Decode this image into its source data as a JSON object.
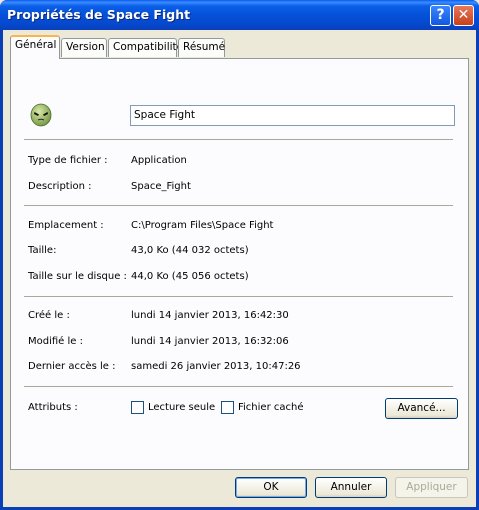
{
  "window": {
    "title": "Propriétés de Space Fight",
    "help_glyph": "?",
    "close_glyph": "✕"
  },
  "tabs": [
    {
      "label": "Général"
    },
    {
      "label": "Version"
    },
    {
      "label": "Compatibilité"
    },
    {
      "label": "Résumé"
    }
  ],
  "general": {
    "name_value": "Space Fight",
    "file_type_label": "Type de fichier :",
    "file_type_value": "Application",
    "description_label": "Description :",
    "description_value": "Space_Fight",
    "location_label": "Emplacement :",
    "location_value": "C:\\Program Files\\Space Fight",
    "size_label": "Taille:",
    "size_value": "43,0 Ko (44 032 octets)",
    "disk_size_label": "Taille sur le disque :",
    "disk_size_value": "44,0 Ko (45 056 octets)",
    "created_label": "Créé le :",
    "created_value": "lundi 14 janvier 2013, 16:42:30",
    "modified_label": "Modifié le :",
    "modified_value": "lundi 14 janvier 2013, 16:32:06",
    "accessed_label": "Dernier accès le :",
    "accessed_value": "samedi 26 janvier 2013, 10:47:26",
    "attributes_label": "Attributs :",
    "readonly_label": "Lecture seule",
    "hidden_label": "Fichier caché",
    "advanced_label": "Avancé..."
  },
  "footer": {
    "ok_label": "OK",
    "cancel_label": "Annuler",
    "apply_label": "Appliquer"
  },
  "icons": {
    "app_icon": "alien-icon"
  }
}
